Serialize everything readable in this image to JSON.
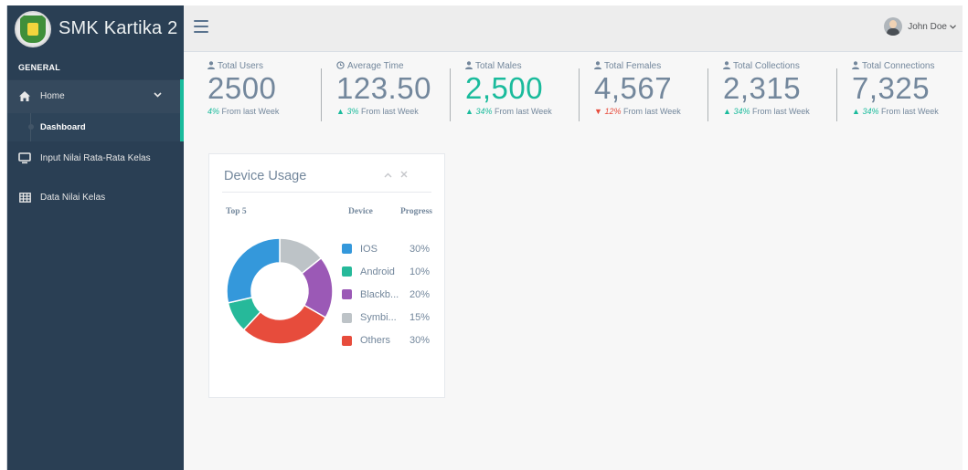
{
  "brand": {
    "title": "SMK Kartika 2"
  },
  "sidebar": {
    "section": "GENERAL",
    "items": [
      {
        "label": "Home",
        "icon": "home-icon"
      },
      {
        "label": "Dashboard",
        "icon": "bullet-icon"
      },
      {
        "label": "Input Nilai Rata-Rata Kelas",
        "icon": "desktop-icon"
      },
      {
        "label": "Data Nilai Kelas",
        "icon": "table-icon"
      }
    ]
  },
  "topnav": {
    "user": "John Doe"
  },
  "stats": [
    {
      "label": "Total Users",
      "value": "2500",
      "pct": "4%",
      "trend": "",
      "suffix": " From last Week",
      "icon": "user-icon"
    },
    {
      "label": "Average Time",
      "value": "123.50",
      "pct": "3%",
      "trend": "up",
      "suffix": " From last Week",
      "icon": "clock-icon"
    },
    {
      "label": "Total Males",
      "value": "2,500",
      "pct": "34%",
      "trend": "up",
      "suffix": " From last Week",
      "icon": "user-icon"
    },
    {
      "label": "Total Females",
      "value": "4,567",
      "pct": "12%",
      "trend": "down",
      "suffix": " From last Week",
      "icon": "user-icon"
    },
    {
      "label": "Total Collections",
      "value": "2,315",
      "pct": "34%",
      "trend": "up",
      "suffix": " From last Week",
      "icon": "user-icon"
    },
    {
      "label": "Total Connections",
      "value": "7,325",
      "pct": "34%",
      "trend": "up",
      "suffix": " From last Week",
      "icon": "user-icon"
    }
  ],
  "device_panel": {
    "title": "Device Usage",
    "headers": {
      "top": "Top 5",
      "device": "Device",
      "progress": "Progress"
    },
    "items": [
      {
        "name": "IOS",
        "pct": "30%",
        "value": 30,
        "color": "#3498DB"
      },
      {
        "name": "Android",
        "pct": "10%",
        "value": 10,
        "color": "#26B99A"
      },
      {
        "name": "Blackb...",
        "pct": "20%",
        "value": 20,
        "color": "#9B59B6"
      },
      {
        "name": "Symbi...",
        "pct": "15%",
        "value": 15,
        "color": "#BDC3C7"
      },
      {
        "name": "Others",
        "pct": "30%",
        "value": 30,
        "color": "#E74C3C"
      }
    ]
  },
  "colors": {
    "sidebar": "#2A3F54",
    "accent": "#1ABB9C",
    "danger": "#E74C3C",
    "text": "#73879C"
  }
}
